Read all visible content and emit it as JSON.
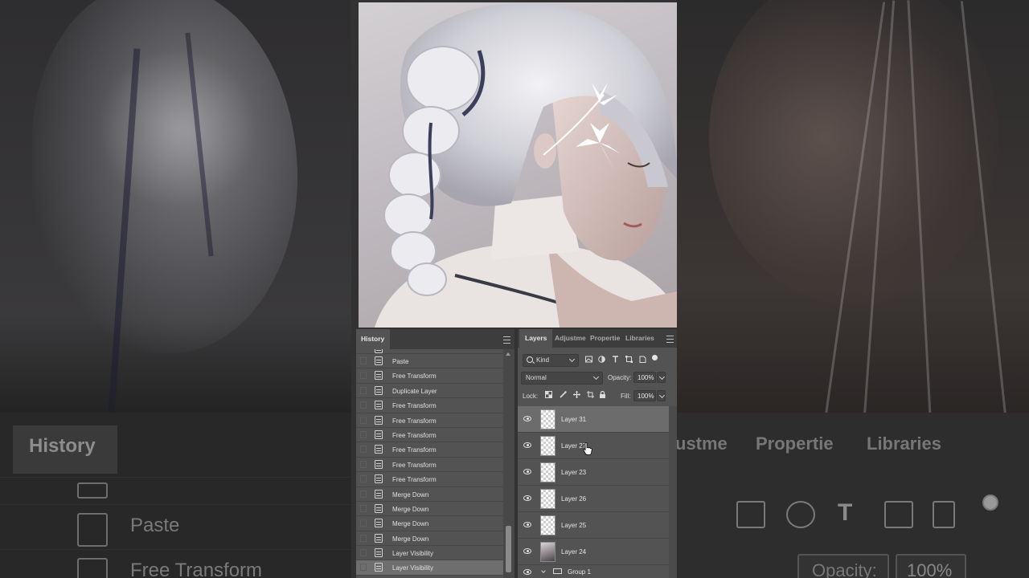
{
  "history_panel": {
    "tab_label": "History",
    "items": [
      {
        "label": "",
        "selected": false
      },
      {
        "label": "Paste",
        "selected": false
      },
      {
        "label": "Free Transform",
        "selected": false
      },
      {
        "label": "Duplicate Layer",
        "selected": false
      },
      {
        "label": "Free Transform",
        "selected": false
      },
      {
        "label": "Free Transform",
        "selected": false
      },
      {
        "label": "Free Transform",
        "selected": false
      },
      {
        "label": "Free Transform",
        "selected": false
      },
      {
        "label": "Free Transform",
        "selected": false
      },
      {
        "label": "Free Transform",
        "selected": false
      },
      {
        "label": "Merge Down",
        "selected": false
      },
      {
        "label": "Merge Down",
        "selected": false
      },
      {
        "label": "Merge Down",
        "selected": false
      },
      {
        "label": "Merge Down",
        "selected": false
      },
      {
        "label": "Layer Visibility",
        "selected": false
      },
      {
        "label": "Layer Visibility",
        "selected": true
      }
    ]
  },
  "layers_panel": {
    "tabs": [
      {
        "label": "Layers",
        "active": true
      },
      {
        "label": "Adjustme",
        "active": false
      },
      {
        "label": "Propertie",
        "active": false
      },
      {
        "label": "Libraries",
        "active": false
      }
    ],
    "filter_kind": "Kind",
    "blend_mode": "Normal",
    "opacity_label": "Opacity:",
    "opacity_value": "100%",
    "lock_label": "Lock:",
    "fill_label": "Fill:",
    "fill_value": "100%",
    "layers": [
      {
        "name": "Layer 31",
        "visible": true,
        "selected": true,
        "thumb": "transparent"
      },
      {
        "name": "Layer 27",
        "visible": true,
        "selected": false,
        "thumb": "transparent"
      },
      {
        "name": "Layer 23",
        "visible": true,
        "selected": false,
        "thumb": "transparent"
      },
      {
        "name": "Layer 26",
        "visible": true,
        "selected": false,
        "thumb": "transparent"
      },
      {
        "name": "Layer 25",
        "visible": true,
        "selected": false,
        "thumb": "transparent"
      },
      {
        "name": "Layer 24",
        "visible": true,
        "selected": false,
        "thumb": "photo"
      }
    ],
    "group_name": "Group 1"
  },
  "background_zoom": {
    "history_tab": "History",
    "rows": [
      "",
      "Paste",
      "Free Transform"
    ],
    "tabs": [
      "ustme",
      "Propertie",
      "Libraries"
    ],
    "opacity_label": "Opacity:",
    "opacity_value": "100%"
  },
  "colors": {
    "panel_bg": "#535353",
    "panel_header": "#3d3d3d",
    "selected_row": "#6e6e6e",
    "hair": "#e8e8ec",
    "ribbon": "#3b3f5c"
  }
}
